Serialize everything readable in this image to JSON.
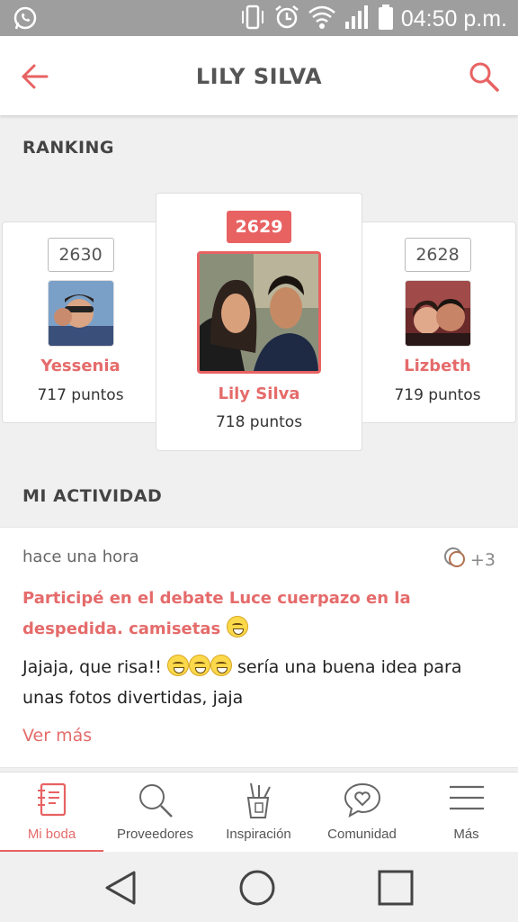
{
  "status_bar": {
    "time": "04:50 p.m."
  },
  "header": {
    "title": "LILY SILVA"
  },
  "ranking": {
    "section_title": "RANKING",
    "cards": [
      {
        "rank": "2630",
        "name": "Yessenia",
        "points": "717 puntos"
      },
      {
        "rank": "2629",
        "name": "Lily Silva",
        "points": "718 puntos"
      },
      {
        "rank": "2628",
        "name": "Lizbeth",
        "points": "719 puntos"
      }
    ]
  },
  "activity": {
    "section_title": "MI ACTIVIDAD",
    "time": "hace una hora",
    "comments": "+3",
    "title": "Participé en el debate Luce cuerpazo en la despedida. camisetas",
    "body_start": "Jajaja, que risa!!",
    "body_end": "sería una buena idea para unas fotos divertidas, jaja",
    "more": "Ver más"
  },
  "tabs": [
    {
      "label": "Mi boda",
      "icon": "notebook-icon",
      "active": true
    },
    {
      "label": "Proveedores",
      "icon": "search-icon"
    },
    {
      "label": "Inspiración",
      "icon": "pencil-cup-icon"
    },
    {
      "label": "Comunidad",
      "icon": "chat-heart-icon"
    },
    {
      "label": "Más",
      "icon": "menu-icon"
    }
  ],
  "colors": {
    "accent": "#e86262",
    "status_bar": "#9e9e9e",
    "background": "#f0f0f0"
  }
}
